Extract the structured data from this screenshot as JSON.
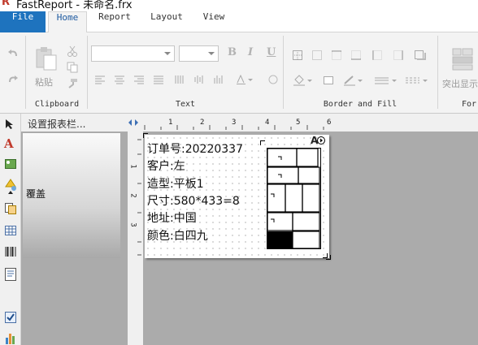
{
  "window": {
    "title": "FastReport - 未命名.frx",
    "logo": "R"
  },
  "tabs": [
    {
      "label": "File"
    },
    {
      "label": "Home"
    },
    {
      "label": "Report"
    },
    {
      "label": "Layout"
    },
    {
      "label": "View"
    }
  ],
  "ribbon": {
    "clipboard": {
      "group_label": "Clipboard",
      "paste_label": "粘贴"
    },
    "text": {
      "group_label": "Text",
      "bold": "B",
      "italic": "I",
      "underline": "U"
    },
    "border_fill": {
      "group_label": "Border and Fill"
    },
    "highlight": {
      "label": "突出显示"
    },
    "format": {
      "group_label": "For"
    }
  },
  "panel": {
    "header": "设置报表栏...",
    "band_label": "覆盖"
  },
  "ruler": {
    "top_ticks": [
      "1",
      "2",
      "3",
      "4",
      "5",
      "6"
    ],
    "left_ticks": [
      "1",
      "2",
      "3"
    ]
  },
  "report": {
    "fields": [
      "订单号:20220337",
      "客户:左",
      "造型:平板1",
      "尺寸:580*433=8",
      "地址:中国",
      "颜色:白四九"
    ],
    "corner_tag": "A"
  },
  "colors": {
    "accent": "#1e73be",
    "logo": "#c0392b",
    "canvas": "#ababab"
  },
  "icons": [
    "undo-icon",
    "redo-icon",
    "paste-icon",
    "cut-icon",
    "copy-icon",
    "format-painter-icon",
    "pointer-icon",
    "text-tool-icon",
    "picture-icon",
    "shape-icon",
    "subreport-icon",
    "table-icon",
    "barcode-icon",
    "rich-text-icon",
    "checkbox-icon",
    "chart-icon"
  ]
}
